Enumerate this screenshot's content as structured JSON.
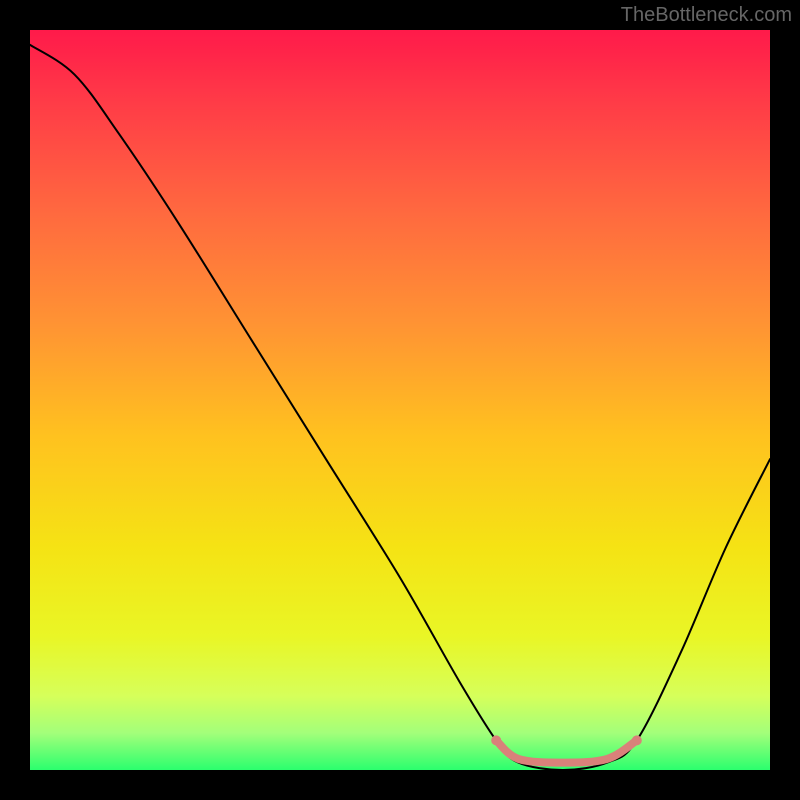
{
  "attribution": "TheBottleneck.com",
  "chart_data": {
    "type": "line",
    "title": "",
    "xlabel": "",
    "ylabel": "",
    "xlim": [
      0,
      100
    ],
    "ylim": [
      0,
      100
    ],
    "grid": false,
    "curve": {
      "points": [
        {
          "x": 0,
          "y": 98
        },
        {
          "x": 6,
          "y": 94
        },
        {
          "x": 12,
          "y": 86
        },
        {
          "x": 20,
          "y": 74
        },
        {
          "x": 30,
          "y": 58
        },
        {
          "x": 40,
          "y": 42
        },
        {
          "x": 50,
          "y": 26
        },
        {
          "x": 58,
          "y": 12
        },
        {
          "x": 63,
          "y": 4
        },
        {
          "x": 66,
          "y": 1
        },
        {
          "x": 72,
          "y": 0
        },
        {
          "x": 78,
          "y": 1
        },
        {
          "x": 82,
          "y": 4
        },
        {
          "x": 88,
          "y": 16
        },
        {
          "x": 94,
          "y": 30
        },
        {
          "x": 100,
          "y": 42
        }
      ],
      "color": "#000000",
      "stroke_width": 2
    },
    "optimal_band": {
      "points": [
        {
          "x": 63,
          "y": 4
        },
        {
          "x": 66,
          "y": 1.5
        },
        {
          "x": 72,
          "y": 1
        },
        {
          "x": 78,
          "y": 1.5
        },
        {
          "x": 82,
          "y": 4
        }
      ],
      "color": "#d9817a",
      "stroke_width": 8,
      "endpoint_radius": 5
    },
    "background_gradient": {
      "stops": [
        {
          "offset": 0.0,
          "color": "#ff1a4a"
        },
        {
          "offset": 0.1,
          "color": "#ff3c47"
        },
        {
          "offset": 0.25,
          "color": "#ff6a3f"
        },
        {
          "offset": 0.4,
          "color": "#ff9433"
        },
        {
          "offset": 0.55,
          "color": "#ffc21f"
        },
        {
          "offset": 0.7,
          "color": "#f5e314"
        },
        {
          "offset": 0.82,
          "color": "#e9f626"
        },
        {
          "offset": 0.9,
          "color": "#d6ff5a"
        },
        {
          "offset": 0.95,
          "color": "#a3ff7a"
        },
        {
          "offset": 1.0,
          "color": "#2bff6e"
        }
      ]
    }
  }
}
